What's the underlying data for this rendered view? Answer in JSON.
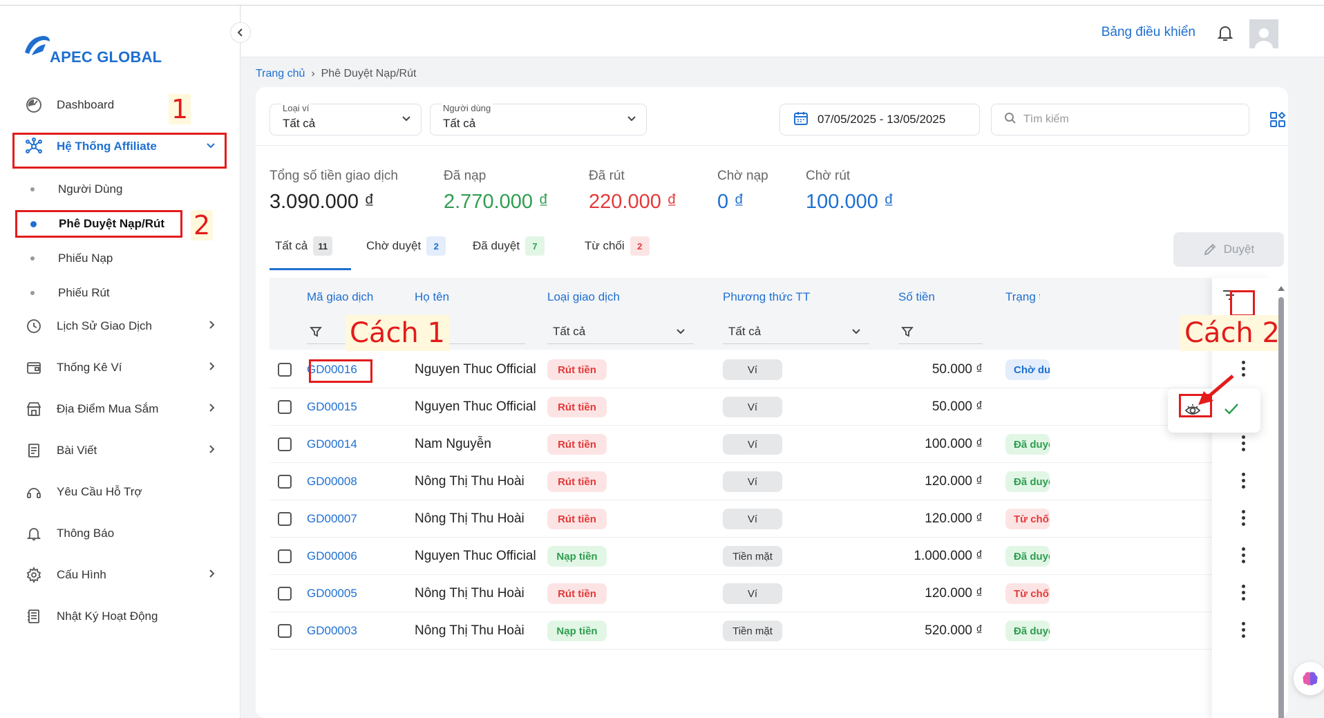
{
  "brand": {
    "name": "APEC GLOBAL",
    "color": "#1e6fd1"
  },
  "sidebar": {
    "items": [
      {
        "label": "Dashboard",
        "icon": "dashboard-icon"
      },
      {
        "label": "Hệ Thống Affiliate",
        "icon": "network-icon",
        "expanded": true
      },
      {
        "label": "Lịch Sử Giao Dịch",
        "icon": "clock-icon"
      },
      {
        "label": "Thống Kê Ví",
        "icon": "wallet-icon"
      },
      {
        "label": "Địa Điểm Mua Sắm",
        "icon": "store-icon"
      },
      {
        "label": "Bài Viết",
        "icon": "document-icon"
      },
      {
        "label": "Yêu Cầu Hỗ Trợ",
        "icon": "support-icon"
      },
      {
        "label": "Thông Báo",
        "icon": "bell-icon"
      },
      {
        "label": "Cấu Hình",
        "icon": "gear-icon"
      },
      {
        "label": "Nhật Ký Hoạt Động",
        "icon": "log-icon"
      }
    ],
    "subitems": [
      {
        "label": "Người Dùng"
      },
      {
        "label": "Phê Duyệt Nạp/Rút",
        "active": true
      },
      {
        "label": "Phiếu Nạp"
      },
      {
        "label": "Phiếu Rút"
      }
    ]
  },
  "annotations": {
    "a1": "1",
    "a2": "2",
    "cach1": "Cách 1",
    "cach2": "Cách 2"
  },
  "header": {
    "dashboard_link": "Bảng điều khiển"
  },
  "breadcrumb": {
    "home": "Trang chủ",
    "current": "Phê Duyệt Nạp/Rút"
  },
  "filters": {
    "wallet": {
      "label": "Loại ví",
      "value": "Tất cả"
    },
    "user": {
      "label": "Người dùng",
      "value": "Tất cả"
    },
    "date_range": "07/05/2025 - 13/05/2025",
    "search_placeholder": "Tìm kiếm"
  },
  "stats": [
    {
      "label": "Tổng số tiền giao dịch",
      "value": "3.090.000 ₫",
      "color": "#222222"
    },
    {
      "label": "Đã nạp",
      "value": "2.770.000 ₫",
      "color": "#2e9e4f"
    },
    {
      "label": "Đã rút",
      "value": "220.000 ₫",
      "color": "#e23a3a"
    },
    {
      "label": "Chờ nạp",
      "value": "0 ₫",
      "color": "#1e6fd1"
    },
    {
      "label": "Chờ rút",
      "value": "100.000 ₫",
      "color": "#1e6fd1"
    }
  ],
  "tabs": [
    {
      "label": "Tất cả",
      "count": "11"
    },
    {
      "label": "Chờ duyệt",
      "count": "2"
    },
    {
      "label": "Đã duyệt",
      "count": "7"
    },
    {
      "label": "Từ chối",
      "count": "2"
    }
  ],
  "approve_button": "Duyệt",
  "table": {
    "columns": [
      "Mã giao dịch",
      "Họ tên",
      "Loại giao dịch",
      "Phương thức TT",
      "Số tiền",
      "Trạng thái"
    ],
    "filters": {
      "type": "Tất cả",
      "method": "Tất cả"
    },
    "rows": [
      {
        "code": "GD00016",
        "name": "Nguyen Thuc Official",
        "type": "Rút tiền",
        "method": "Ví",
        "amount": "50.000 ₫",
        "status": "Chờ duyệt"
      },
      {
        "code": "GD00015",
        "name": "Nguyen Thuc Official",
        "type": "Rút tiền",
        "method": "Ví",
        "amount": "50.000 ₫",
        "status": ""
      },
      {
        "code": "GD00014",
        "name": "Nam Nguyễn",
        "type": "Rút tiền",
        "method": "Ví",
        "amount": "100.000 ₫",
        "status": "Đã duyệt"
      },
      {
        "code": "GD00008",
        "name": "Nông Thị Thu Hoài",
        "type": "Rút tiền",
        "method": "Ví",
        "amount": "120.000 ₫",
        "status": "Đã duyệt"
      },
      {
        "code": "GD00007",
        "name": "Nông Thị Thu Hoài",
        "type": "Rút tiền",
        "method": "Ví",
        "amount": "120.000 ₫",
        "status": "Từ chối"
      },
      {
        "code": "GD00006",
        "name": "Nguyen Thuc Official",
        "type": "Nạp tiền",
        "method": "Tiền mặt",
        "amount": "1.000.000 ₫",
        "status": "Đã duyệt"
      },
      {
        "code": "GD00005",
        "name": "Nông Thị Thu Hoài",
        "type": "Rút tiền",
        "method": "Ví",
        "amount": "120.000 ₫",
        "status": "Từ chối"
      },
      {
        "code": "GD00003",
        "name": "Nông Thị Thu Hoài",
        "type": "Nạp tiền",
        "method": "Tiền mặt",
        "amount": "520.000 ₫",
        "status": "Đã duyệt"
      }
    ]
  }
}
